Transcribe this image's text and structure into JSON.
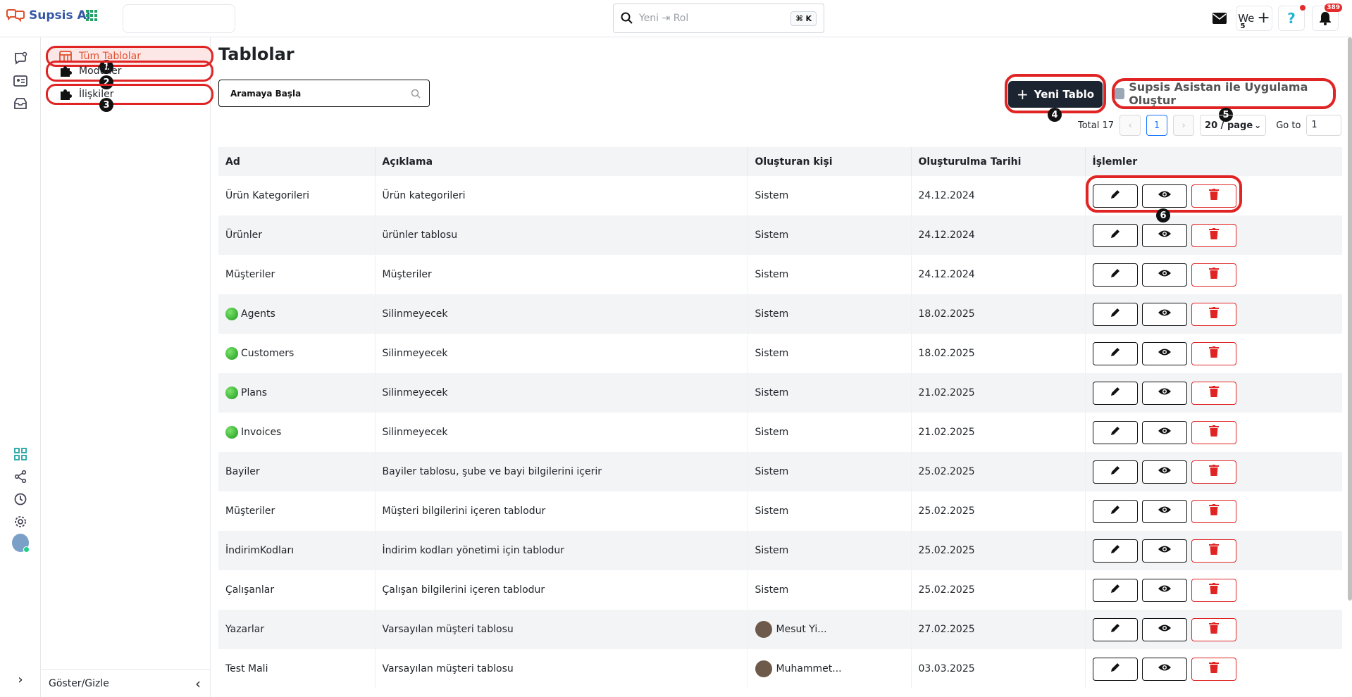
{
  "brand": {
    "name": "Supsis Ai"
  },
  "topbar": {
    "search_placeholder": "Yeni ⇥ Rol",
    "search_shortcut": "⌘ K",
    "workspace_label": "We",
    "notification_count": "389"
  },
  "sidebar": {
    "items": [
      {
        "label": "Tüm Tablolar",
        "num": "1"
      },
      {
        "label": "Modüller",
        "num": "2"
      },
      {
        "label": "İlişkiler",
        "num": "3"
      }
    ],
    "footer_label": "Göster/Gizle"
  },
  "main": {
    "title": "Tablolar",
    "search_placeholder": "Aramaya Başla",
    "new_table_label": "Yeni Tablo",
    "new_table_num": "4",
    "assistant_label": "Supsis Asistan ile Uygulama Oluştur",
    "assistant_num": "5",
    "actions_num": "6",
    "workspace_num": "5"
  },
  "pagination": {
    "total_label": "Total 17",
    "current_page": "1",
    "page_size": "20 / page",
    "goto_label": "Go to",
    "goto_value": "1"
  },
  "table": {
    "headers": [
      "Ad",
      "Açıklama",
      "Oluşturan kişi",
      "Oluşturulma Tarihi",
      "İşlemler"
    ],
    "rows": [
      {
        "name": "Ürün Kategorileri",
        "desc": "Ürün kategorileri",
        "creator": "Sistem",
        "date": "24.12.2024",
        "dot": false,
        "avatar": false
      },
      {
        "name": "Ürünler",
        "desc": "ürünler tablosu",
        "creator": "Sistem",
        "date": "24.12.2024",
        "dot": false,
        "avatar": false
      },
      {
        "name": "Müşteriler",
        "desc": "Müşteriler",
        "creator": "Sistem",
        "date": "24.12.2024",
        "dot": false,
        "avatar": false
      },
      {
        "name": "Agents",
        "desc": "Silinmeyecek",
        "creator": "Sistem",
        "date": "18.02.2025",
        "dot": true,
        "avatar": false
      },
      {
        "name": "Customers",
        "desc": "Silinmeyecek",
        "creator": "Sistem",
        "date": "18.02.2025",
        "dot": true,
        "avatar": false
      },
      {
        "name": "Plans",
        "desc": "Silinmeyecek",
        "creator": "Sistem",
        "date": "21.02.2025",
        "dot": true,
        "avatar": false
      },
      {
        "name": "Invoices",
        "desc": "Silinmeyecek",
        "creator": "Sistem",
        "date": "21.02.2025",
        "dot": true,
        "avatar": false
      },
      {
        "name": "Bayiler",
        "desc": "Bayiler tablosu, şube ve bayi bilgilerini içerir",
        "creator": "Sistem",
        "date": "25.02.2025",
        "dot": false,
        "avatar": false
      },
      {
        "name": "Müşteriler",
        "desc": "Müşteri bilgilerini içeren tablodur",
        "creator": "Sistem",
        "date": "25.02.2025",
        "dot": false,
        "avatar": false
      },
      {
        "name": "İndirimKodları",
        "desc": "İndirim kodları yönetimi için tablodur",
        "creator": "Sistem",
        "date": "25.02.2025",
        "dot": false,
        "avatar": false
      },
      {
        "name": "Çalışanlar",
        "desc": "Çalışan bilgilerini içeren tablodur",
        "creator": "Sistem",
        "date": "25.02.2025",
        "dot": false,
        "avatar": false
      },
      {
        "name": "Yazarlar",
        "desc": "Varsayılan müşteri tablosu",
        "creator": "Mesut Yi...",
        "date": "27.02.2025",
        "dot": false,
        "avatar": true
      },
      {
        "name": "Test Mali",
        "desc": "Varsayılan müşteri tablosu",
        "creator": "Muhammet...",
        "date": "03.03.2025",
        "dot": false,
        "avatar": true
      }
    ]
  },
  "colors": {
    "accent_red": "#e02424",
    "brand_blue": "#3557a6",
    "dark_button": "#1c2431"
  }
}
